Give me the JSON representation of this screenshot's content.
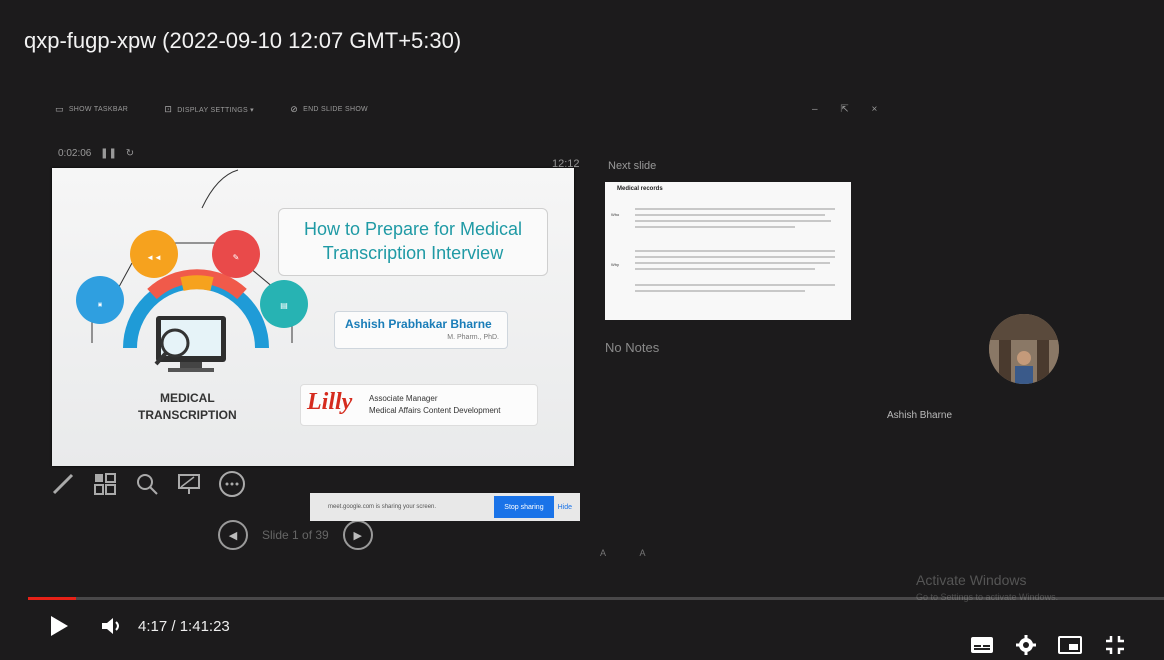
{
  "video": {
    "title": "qxp-fugp-xpw (2022-09-10 12:07 GMT+5:30)",
    "time_current": "4:17",
    "time_total": "1:41:23",
    "progress_fraction": 0.042,
    "accent_color": "#e62117"
  },
  "presenter": {
    "toolbar": {
      "show_taskbar": "SHOW TASKBAR",
      "display_settings": "DISPLAY SETTINGS ▾",
      "end_slideshow": "END SLIDE SHOW"
    },
    "timer": "0:02:06",
    "clock": "12:12",
    "next_slide_label": "Next slide",
    "notes": "No Notes",
    "slide_counter": "Slide 1 of 39",
    "font_controls": "A A"
  },
  "slide": {
    "title_line1": "How to Prepare for Medical",
    "title_line2": "Transcription Interview",
    "author": "Ashish Prabhakar Bharne",
    "degree": "M. Pharm., PhD.",
    "company": "Lilly",
    "role_line1": "Associate Manager",
    "role_line2": "Medical Affairs Content Development",
    "graphic_line1": "MEDICAL",
    "graphic_line2": "TRANSCRIPTION"
  },
  "next_slide": {
    "title": "Medical records",
    "label1": "Who",
    "label2": "Why"
  },
  "screen_share": {
    "message": "meet.google.com is sharing your screen.",
    "stop_label": "Stop sharing",
    "hide_label": "Hide"
  },
  "participant": {
    "name": "Ashish Bharne"
  },
  "watermark": {
    "line1": "Activate Windows",
    "line2": "Go to Settings to activate Windows."
  }
}
